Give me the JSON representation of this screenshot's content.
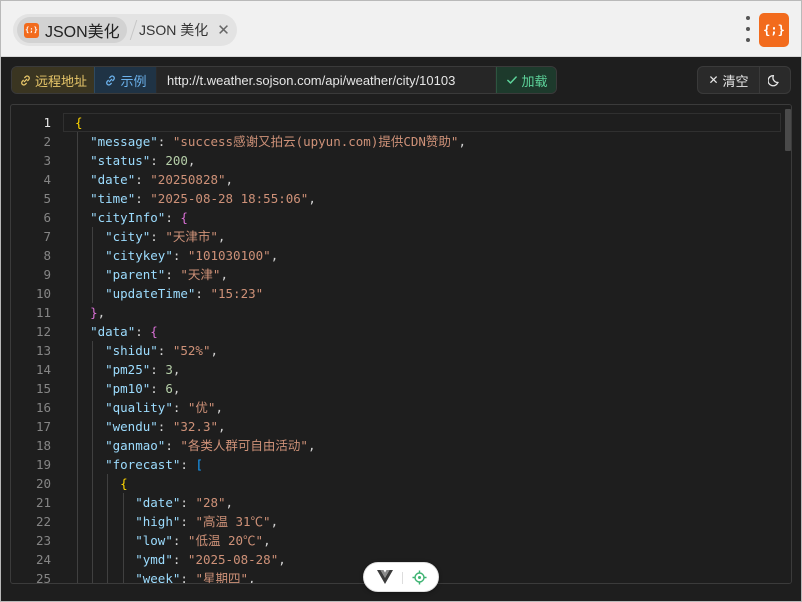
{
  "tabs": [
    {
      "logo_text": "{;}",
      "title": "JSON美化",
      "active": true
    },
    {
      "title": "JSON 美化",
      "close": "✕",
      "active": false
    }
  ],
  "app_logo": "{;}",
  "toolbar": {
    "remote_label": "远程地址",
    "example_label": "示例",
    "url_value": "http://t.weather.sojson.com/api/weather/city/10103",
    "load_label": "加载",
    "clear_label": "清空",
    "icons": {
      "remote": "link-icon",
      "example": "link-icon",
      "load": "check-icon",
      "clear": "close-icon",
      "theme": "moon-icon"
    }
  },
  "colors": {
    "key": "#9cdcfe",
    "string": "#ce9178",
    "number": "#b5cea8",
    "bracket_level1": "#ffd700",
    "bracket_level2": "#da70d6",
    "bracket_level3": "#179fff",
    "remote_btn": "#e8c76a",
    "example_btn": "#6cb2ec",
    "load_btn": "#5dd39a",
    "brand": "#f26b1d"
  },
  "editor": {
    "line_numbers": [
      "1",
      "2",
      "3",
      "4",
      "5",
      "6",
      "7",
      "8",
      "9",
      "10",
      "11",
      "12",
      "13",
      "14",
      "15",
      "16",
      "17",
      "18",
      "19",
      "20",
      "21",
      "22",
      "23",
      "24",
      "25"
    ],
    "lines": [
      [
        {
          "t": "{",
          "c": "b1"
        }
      ],
      [
        {
          "t": "  "
        },
        {
          "t": "\"message\"",
          "c": "k"
        },
        {
          "t": ": "
        },
        {
          "t": "\"success感谢又拍云(upyun.com)提供CDN赞助\"",
          "c": "s"
        },
        {
          "t": ","
        }
      ],
      [
        {
          "t": "  "
        },
        {
          "t": "\"status\"",
          "c": "k"
        },
        {
          "t": ": "
        },
        {
          "t": "200",
          "c": "n"
        },
        {
          "t": ","
        }
      ],
      [
        {
          "t": "  "
        },
        {
          "t": "\"date\"",
          "c": "k"
        },
        {
          "t": ": "
        },
        {
          "t": "\"20250828\"",
          "c": "s"
        },
        {
          "t": ","
        }
      ],
      [
        {
          "t": "  "
        },
        {
          "t": "\"time\"",
          "c": "k"
        },
        {
          "t": ": "
        },
        {
          "t": "\"2025-08-28 18:55:06\"",
          "c": "s"
        },
        {
          "t": ","
        }
      ],
      [
        {
          "t": "  "
        },
        {
          "t": "\"cityInfo\"",
          "c": "k"
        },
        {
          "t": ": "
        },
        {
          "t": "{",
          "c": "b2"
        }
      ],
      [
        {
          "t": "    "
        },
        {
          "t": "\"city\"",
          "c": "k"
        },
        {
          "t": ": "
        },
        {
          "t": "\"天津市\"",
          "c": "s"
        },
        {
          "t": ","
        }
      ],
      [
        {
          "t": "    "
        },
        {
          "t": "\"citykey\"",
          "c": "k"
        },
        {
          "t": ": "
        },
        {
          "t": "\"101030100\"",
          "c": "s"
        },
        {
          "t": ","
        }
      ],
      [
        {
          "t": "    "
        },
        {
          "t": "\"parent\"",
          "c": "k"
        },
        {
          "t": ": "
        },
        {
          "t": "\"天津\"",
          "c": "s"
        },
        {
          "t": ","
        }
      ],
      [
        {
          "t": "    "
        },
        {
          "t": "\"updateTime\"",
          "c": "k"
        },
        {
          "t": ": "
        },
        {
          "t": "\"15:23\"",
          "c": "s"
        }
      ],
      [
        {
          "t": "  "
        },
        {
          "t": "}",
          "c": "b2"
        },
        {
          "t": ","
        }
      ],
      [
        {
          "t": "  "
        },
        {
          "t": "\"data\"",
          "c": "k"
        },
        {
          "t": ": "
        },
        {
          "t": "{",
          "c": "b2"
        }
      ],
      [
        {
          "t": "    "
        },
        {
          "t": "\"shidu\"",
          "c": "k"
        },
        {
          "t": ": "
        },
        {
          "t": "\"52%\"",
          "c": "s"
        },
        {
          "t": ","
        }
      ],
      [
        {
          "t": "    "
        },
        {
          "t": "\"pm25\"",
          "c": "k"
        },
        {
          "t": ": "
        },
        {
          "t": "3",
          "c": "n"
        },
        {
          "t": ","
        }
      ],
      [
        {
          "t": "    "
        },
        {
          "t": "\"pm10\"",
          "c": "k"
        },
        {
          "t": ": "
        },
        {
          "t": "6",
          "c": "n"
        },
        {
          "t": ","
        }
      ],
      [
        {
          "t": "    "
        },
        {
          "t": "\"quality\"",
          "c": "k"
        },
        {
          "t": ": "
        },
        {
          "t": "\"优\"",
          "c": "s"
        },
        {
          "t": ","
        }
      ],
      [
        {
          "t": "    "
        },
        {
          "t": "\"wendu\"",
          "c": "k"
        },
        {
          "t": ": "
        },
        {
          "t": "\"32.3\"",
          "c": "s"
        },
        {
          "t": ","
        }
      ],
      [
        {
          "t": "    "
        },
        {
          "t": "\"ganmao\"",
          "c": "k"
        },
        {
          "t": ": "
        },
        {
          "t": "\"各类人群可自由活动\"",
          "c": "s"
        },
        {
          "t": ","
        }
      ],
      [
        {
          "t": "    "
        },
        {
          "t": "\"forecast\"",
          "c": "k"
        },
        {
          "t": ": "
        },
        {
          "t": "[",
          "c": "b3"
        }
      ],
      [
        {
          "t": "      "
        },
        {
          "t": "{",
          "c": "b1"
        }
      ],
      [
        {
          "t": "        "
        },
        {
          "t": "\"date\"",
          "c": "k"
        },
        {
          "t": ": "
        },
        {
          "t": "\"28\"",
          "c": "s"
        },
        {
          "t": ","
        }
      ],
      [
        {
          "t": "        "
        },
        {
          "t": "\"high\"",
          "c": "k"
        },
        {
          "t": ": "
        },
        {
          "t": "\"高温 31℃\"",
          "c": "s"
        },
        {
          "t": ","
        }
      ],
      [
        {
          "t": "        "
        },
        {
          "t": "\"low\"",
          "c": "k"
        },
        {
          "t": ": "
        },
        {
          "t": "\"低温 20℃\"",
          "c": "s"
        },
        {
          "t": ","
        }
      ],
      [
        {
          "t": "        "
        },
        {
          "t": "\"ymd\"",
          "c": "k"
        },
        {
          "t": ": "
        },
        {
          "t": "\"2025-08-28\"",
          "c": "s"
        },
        {
          "t": ","
        }
      ],
      [
        {
          "t": "        "
        },
        {
          "t": "\"week\"",
          "c": "k"
        },
        {
          "t": ": "
        },
        {
          "t": "\"星期四\"",
          "c": "s"
        },
        {
          "t": ","
        }
      ]
    ]
  },
  "floating_toolbar": {
    "icons": [
      "vue-icon",
      "target-icon"
    ]
  }
}
